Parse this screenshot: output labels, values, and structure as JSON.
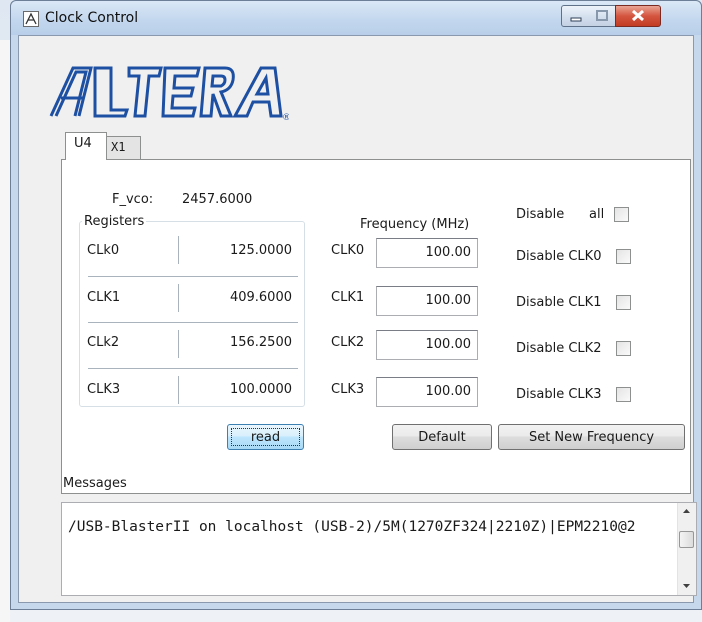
{
  "window": {
    "title": "Clock Control"
  },
  "logo": {
    "text": "ALTERA",
    "registered_mark": "®",
    "color": "#1d4fa2"
  },
  "tabs": [
    {
      "label": "U4",
      "selected": true
    },
    {
      "label": "X1",
      "selected": false
    }
  ],
  "fvco": {
    "label": "F_vco:",
    "value": "2457.6000"
  },
  "registers": {
    "title": "Registers",
    "rows": [
      {
        "label": "CLk0",
        "value": "125.0000"
      },
      {
        "label": "CLK1",
        "value": "409.6000"
      },
      {
        "label": "CLk2",
        "value": "156.2500"
      },
      {
        "label": "CLK3",
        "value": "100.0000"
      }
    ]
  },
  "frequency": {
    "header": "Frequency (MHz)",
    "rows": [
      {
        "label": "CLK0",
        "value": "100.00"
      },
      {
        "label": "CLK1",
        "value": "100.00"
      },
      {
        "label": "CLK2",
        "value": "100.00"
      },
      {
        "label": "CLK3",
        "value": "100.00"
      }
    ]
  },
  "disable": {
    "header": "Disable",
    "all_label": "all",
    "all_checked": false,
    "rows": [
      {
        "label": "Disable CLK0",
        "checked": false
      },
      {
        "label": "Disable CLK1",
        "checked": false
      },
      {
        "label": "Disable CLK2",
        "checked": false
      },
      {
        "label": "Disable CLK3",
        "checked": false
      }
    ]
  },
  "buttons": {
    "read": "read",
    "default": "Default",
    "set_new_frequency": "Set New Frequency"
  },
  "messages": {
    "label": "Messages",
    "text": "/USB-BlasterII on localhost (USB-2)/5M(1270ZF324|2210Z)|EPM2210@2"
  }
}
